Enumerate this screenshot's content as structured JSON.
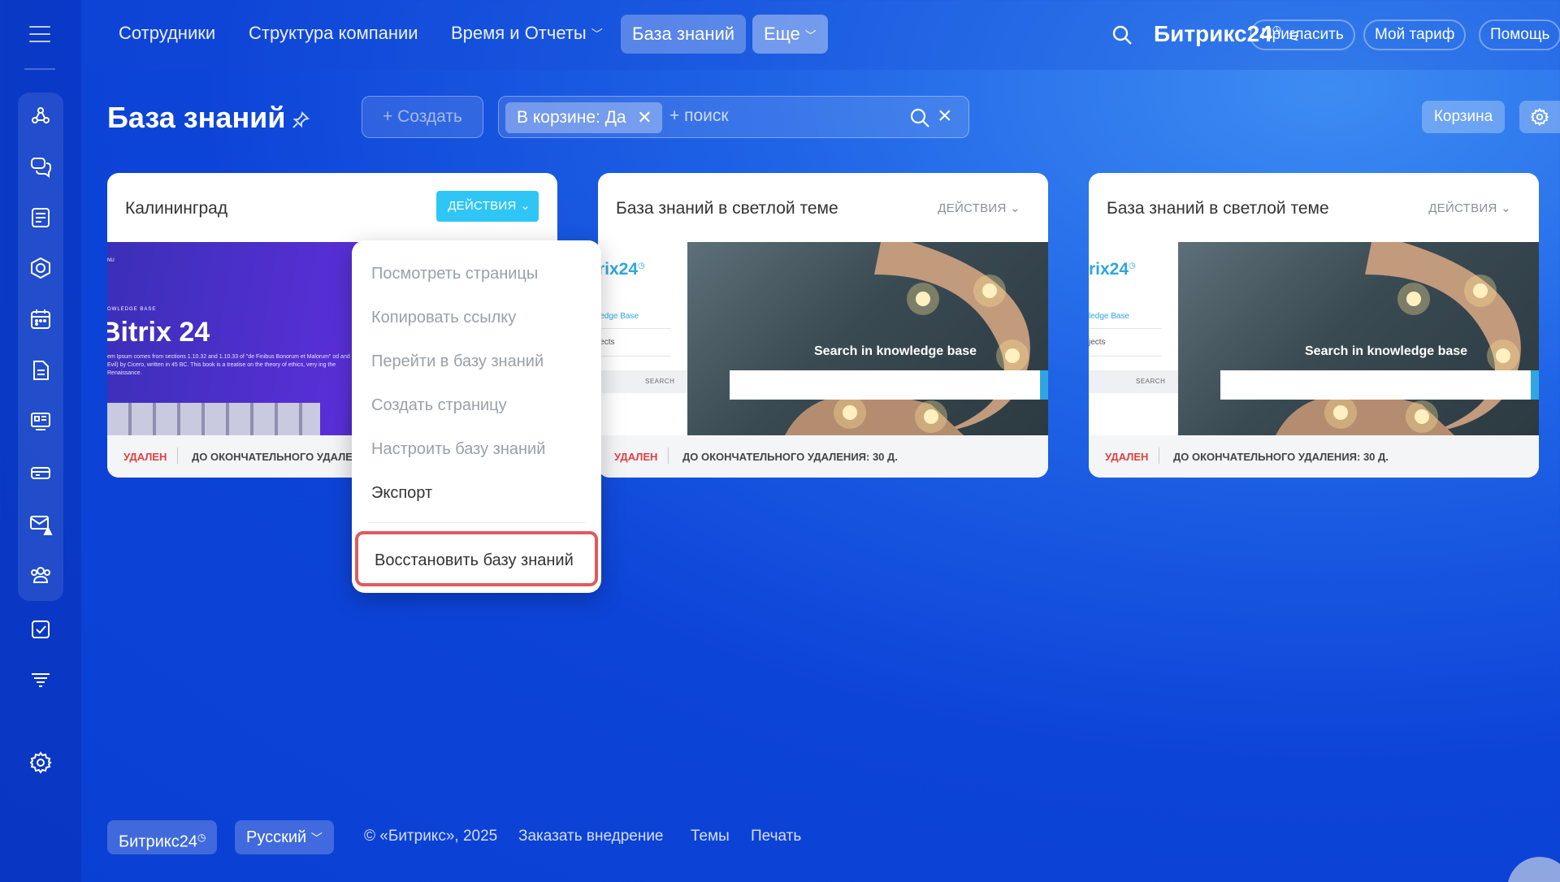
{
  "nav": {
    "items": [
      "Сотрудники",
      "Структура компании",
      "Время и Отчеты"
    ],
    "active": "База знаний",
    "more": "Еще",
    "brand": "Битрикс",
    "brand_num": "24",
    "invite": "Пригласить",
    "tariff": "Мой тариф",
    "help": "Помощь"
  },
  "page": {
    "title": "База знаний",
    "create_label": "+ Создать",
    "filter_tag": "В корзине: Да",
    "search_placeholder": "+ поиск",
    "trash_label": "Корзина"
  },
  "cards": [
    {
      "title": "Калининград",
      "actions": "ДЕЙСТВИЯ",
      "status": "УДАЛЕН",
      "days_label": "ДО ОКОНЧАТЕЛЬНОГО УДАЛЕНИЯ: 30 Д.",
      "preview": {
        "menu": "NU",
        "small": "OWLEDGE BASE",
        "big": "Bitrix 24",
        "text": "em Ipsum comes from sections 1.10.32 and 1.10.33 of \"de Finibus Bonorum et Malorum\" od and Evil) by Cicero, written in 45 BC. This book is a treatise on the theory of ethics, very ing the Renaissance."
      }
    },
    {
      "title": "База знаний в светлой теме",
      "actions": "ДЕЙСТВИЯ",
      "status": "УДАЛЕН",
      "days_label": "ДО ОКОНЧАТЕЛЬНОГО УДАЛЕНИЯ: 30 Д.",
      "preview": {
        "logo": "rix24",
        "crumb": "ledge Base",
        "proj": "jects",
        "search_btn": "SEARCH",
        "heading": "Search in knowledge base"
      }
    },
    {
      "title": "База знаний в светлой теме",
      "actions": "ДЕЙСТВИЯ",
      "status": "УДАЛЕН",
      "days_label": "ДО ОКОНЧАТЕЛЬНОГО УДАЛЕНИЯ: 30 Д.",
      "preview": {
        "logo": "rix24",
        "crumb": "ledge Base",
        "proj": "jects",
        "search_btn": "SEARCH",
        "heading": "Search in knowledge base"
      }
    }
  ],
  "dropdown": {
    "items": [
      "Посмотреть страницы",
      "Копировать ссылку",
      "Перейти в базу знаний",
      "Создать страницу",
      "Настроить базу знаний",
      "Экспорт"
    ],
    "restore": "Восстановить базу знаний"
  },
  "footer": {
    "brand": "Битрикс24",
    "language": "Русский",
    "copyright": "© «Битрикс», 2025",
    "order": "Заказать внедрение",
    "themes": "Темы",
    "print": "Печать"
  },
  "colors": {
    "accent": "#2fc6f6",
    "deleted": "#e13f3f",
    "highlight": "#e05a5f"
  }
}
